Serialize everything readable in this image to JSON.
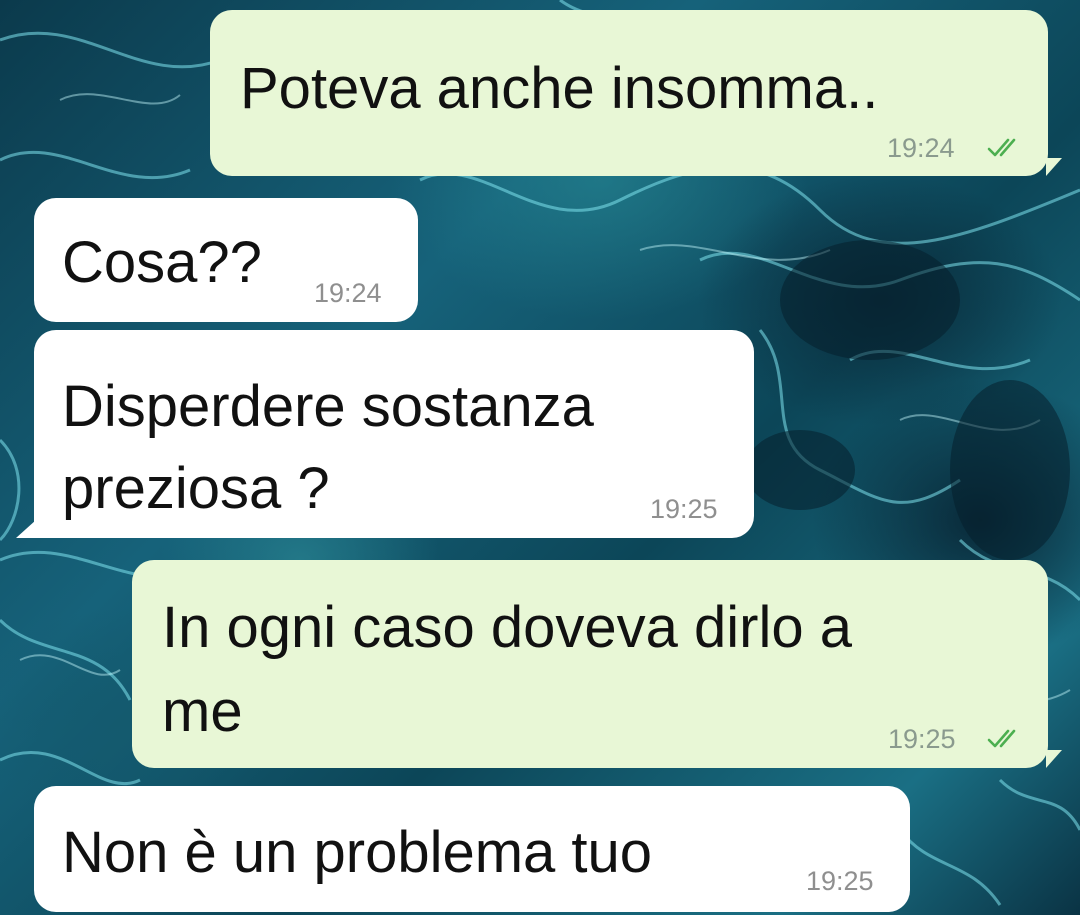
{
  "colors": {
    "outgoing_bubble": "#e8f7d6",
    "incoming_bubble": "#ffffff",
    "read_ticks": "#34b7f1",
    "wallpaper": "#0e4a5e"
  },
  "messages": [
    {
      "direction": "outgoing",
      "text": "Poteva anche insomma..",
      "time": "19:24",
      "status_icon": "double-check-icon"
    },
    {
      "direction": "incoming",
      "text": "Cosa??",
      "time": "19:24"
    },
    {
      "direction": "incoming",
      "text": "Disperdere sostanza\npreziosa ?",
      "time": "19:25"
    },
    {
      "direction": "outgoing",
      "text": "In ogni caso doveva dirlo a\nme",
      "time": "19:25",
      "status_icon": "double-check-icon"
    },
    {
      "direction": "incoming",
      "text": "Non è un problema tuo",
      "time": "19:25"
    }
  ]
}
